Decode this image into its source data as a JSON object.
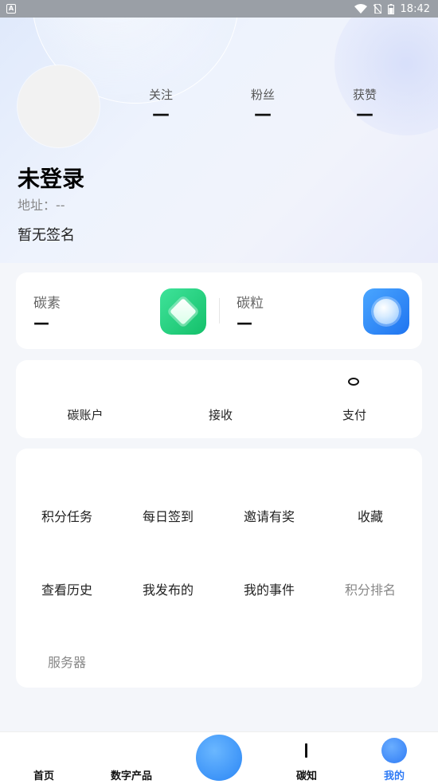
{
  "status_bar": {
    "time": "18:42",
    "app_badge": "A"
  },
  "profile": {
    "username": "未登录",
    "address": "地址：--",
    "signature": "暂无签名",
    "stats": [
      {
        "label": "关注",
        "value": "—"
      },
      {
        "label": "粉丝",
        "value": "—"
      },
      {
        "label": "获赞",
        "value": "—"
      }
    ]
  },
  "currencies": [
    {
      "label": "碳素",
      "value": "—",
      "icon": "green-diamond-icon"
    },
    {
      "label": "碳粒",
      "value": "—",
      "icon": "blue-orb-icon"
    }
  ],
  "account_actions": [
    {
      "label": "碳账户"
    },
    {
      "label": "接收"
    },
    {
      "label": "支付"
    }
  ],
  "menu": [
    {
      "label": "积分任务"
    },
    {
      "label": "每日签到"
    },
    {
      "label": "邀请有奖"
    },
    {
      "label": "收藏"
    },
    {
      "label": "查看历史"
    },
    {
      "label": "我发布的"
    },
    {
      "label": "我的事件"
    },
    {
      "label": "积分排名"
    },
    {
      "label": "服务器"
    }
  ],
  "tabbar": [
    {
      "label": "首页"
    },
    {
      "label": "数字产品"
    },
    {
      "label": "碳知"
    },
    {
      "label": "我的"
    }
  ],
  "colors": {
    "accent": "#2f7bf5",
    "green_tile": "#1fcf7c",
    "blue_tile": "#2f86f5"
  }
}
